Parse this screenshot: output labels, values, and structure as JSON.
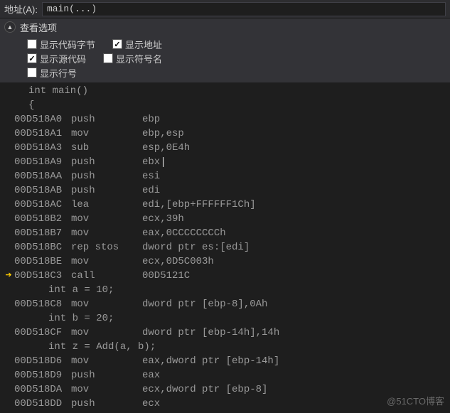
{
  "address_bar": {
    "label": "地址(A):",
    "value": "main(...)"
  },
  "options": {
    "header": "查看选项",
    "items": [
      {
        "label": "显示代码字节",
        "checked": false
      },
      {
        "label": "显示地址",
        "checked": true
      },
      {
        "label": "显示源代码",
        "checked": true
      },
      {
        "label": "显示符号名",
        "checked": false
      },
      {
        "label": "显示行号",
        "checked": false
      }
    ]
  },
  "disasm": {
    "cursor_line": 6,
    "current_arrow_line": 16,
    "lines": [
      {
        "type": "src",
        "indent": 0,
        "text": "int main()"
      },
      {
        "type": "src",
        "indent": 0,
        "text": "{"
      },
      {
        "type": "asm",
        "addr": "00D518A0",
        "mne": "push",
        "ops": "ebp"
      },
      {
        "type": "asm",
        "addr": "00D518A1",
        "mne": "mov",
        "ops": "ebp,esp"
      },
      {
        "type": "asm",
        "addr": "00D518A3",
        "mne": "sub",
        "ops": "esp,0E4h"
      },
      {
        "type": "asm",
        "addr": "00D518A9",
        "mne": "push",
        "ops": "ebx"
      },
      {
        "type": "asm",
        "addr": "00D518AA",
        "mne": "push",
        "ops": "esi"
      },
      {
        "type": "asm",
        "addr": "00D518AB",
        "mne": "push",
        "ops": "edi"
      },
      {
        "type": "asm",
        "addr": "00D518AC",
        "mne": "lea",
        "ops": "edi,[ebp+FFFFFF1Ch]"
      },
      {
        "type": "asm",
        "addr": "00D518B2",
        "mne": "mov",
        "ops": "ecx,39h"
      },
      {
        "type": "asm",
        "addr": "00D518B7",
        "mne": "mov",
        "ops": "eax,0CCCCCCCCh"
      },
      {
        "type": "asm",
        "addr": "00D518BC",
        "mne": "rep stos",
        "ops": "dword ptr es:[edi]"
      },
      {
        "type": "asm",
        "addr": "00D518BE",
        "mne": "mov",
        "ops": "ecx,0D5C003h"
      },
      {
        "type": "asm",
        "addr": "00D518C3",
        "mne": "call",
        "ops": "00D5121C"
      },
      {
        "type": "src",
        "indent": 1,
        "text": "int a = 10;"
      },
      {
        "type": "asm",
        "addr": "00D518C8",
        "mne": "mov",
        "ops": "dword ptr [ebp-8],0Ah"
      },
      {
        "type": "src",
        "indent": 1,
        "text": "int b = 20;"
      },
      {
        "type": "asm",
        "addr": "00D518CF",
        "mne": "mov",
        "ops": "dword ptr [ebp-14h],14h"
      },
      {
        "type": "src",
        "indent": 1,
        "text": "int z = Add(a, b);"
      },
      {
        "type": "asm",
        "addr": "00D518D6",
        "mne": "mov",
        "ops": "eax,dword ptr [ebp-14h]"
      },
      {
        "type": "asm",
        "addr": "00D518D9",
        "mne": "push",
        "ops": "eax"
      },
      {
        "type": "asm",
        "addr": "00D518DA",
        "mne": "mov",
        "ops": "ecx,dword ptr [ebp-8]"
      },
      {
        "type": "asm",
        "addr": "00D518DD",
        "mne": "push",
        "ops": "ecx"
      }
    ]
  },
  "watermark": "@51CTO博客"
}
